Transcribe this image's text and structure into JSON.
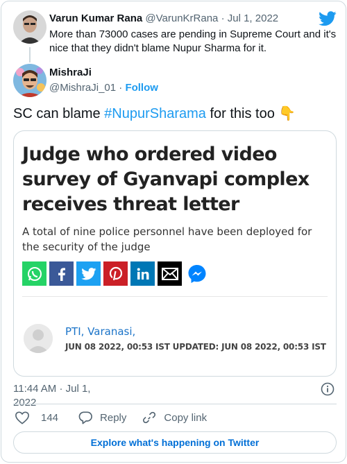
{
  "reply_tweet": {
    "author_name": "Varun Kumar Rana",
    "handle": "@VarunKrRana",
    "separator": "·",
    "date": "Jul 1, 2022",
    "text": "More than 73000 cases are pending in Supreme Court and it's nice that they didn't blame Nupur Sharma for it."
  },
  "main_tweet": {
    "author_name": "MishraJi",
    "handle": "@MishraJi_01",
    "separator": "·",
    "follow_label": "Follow",
    "text_before": "SC can blame ",
    "hashtag": "#NupurSharama",
    "text_after": " for this too ",
    "emoji": "👇"
  },
  "media": {
    "headline": "Judge who ordered video survey of Gyanvapi complex receives threat letter",
    "summary": "A total of nine police personnel have been deployed for the security of the judge",
    "share_icons": [
      {
        "name": "whatsapp-icon",
        "color": "#25d366"
      },
      {
        "name": "facebook-icon",
        "color": "#3b5998"
      },
      {
        "name": "twitter-share-icon",
        "color": "#1da1f2"
      },
      {
        "name": "pinterest-icon",
        "color": "#cb2027"
      },
      {
        "name": "linkedin-icon",
        "color": "#0077b5"
      },
      {
        "name": "email-icon",
        "color": "#000000"
      },
      {
        "name": "messenger-icon",
        "color": "#0084ff"
      }
    ],
    "byline_source": "PTI, Varanasi,",
    "byline_date": "JUN 08 2022, 00:53 IST UPDATED: JUN 08 2022, 00:53 IST"
  },
  "meta": {
    "time": "11:44 AM",
    "separator": "·",
    "date": "Jul 1, 2022"
  },
  "actions": {
    "like_count": "144",
    "reply_label": "Reply",
    "copy_link_label": "Copy link"
  },
  "explore_label": "Explore what's happening on Twitter",
  "colors": {
    "twitter_blue": "#1d9bf0",
    "muted_text": "#536471",
    "border": "#cfd9de"
  }
}
